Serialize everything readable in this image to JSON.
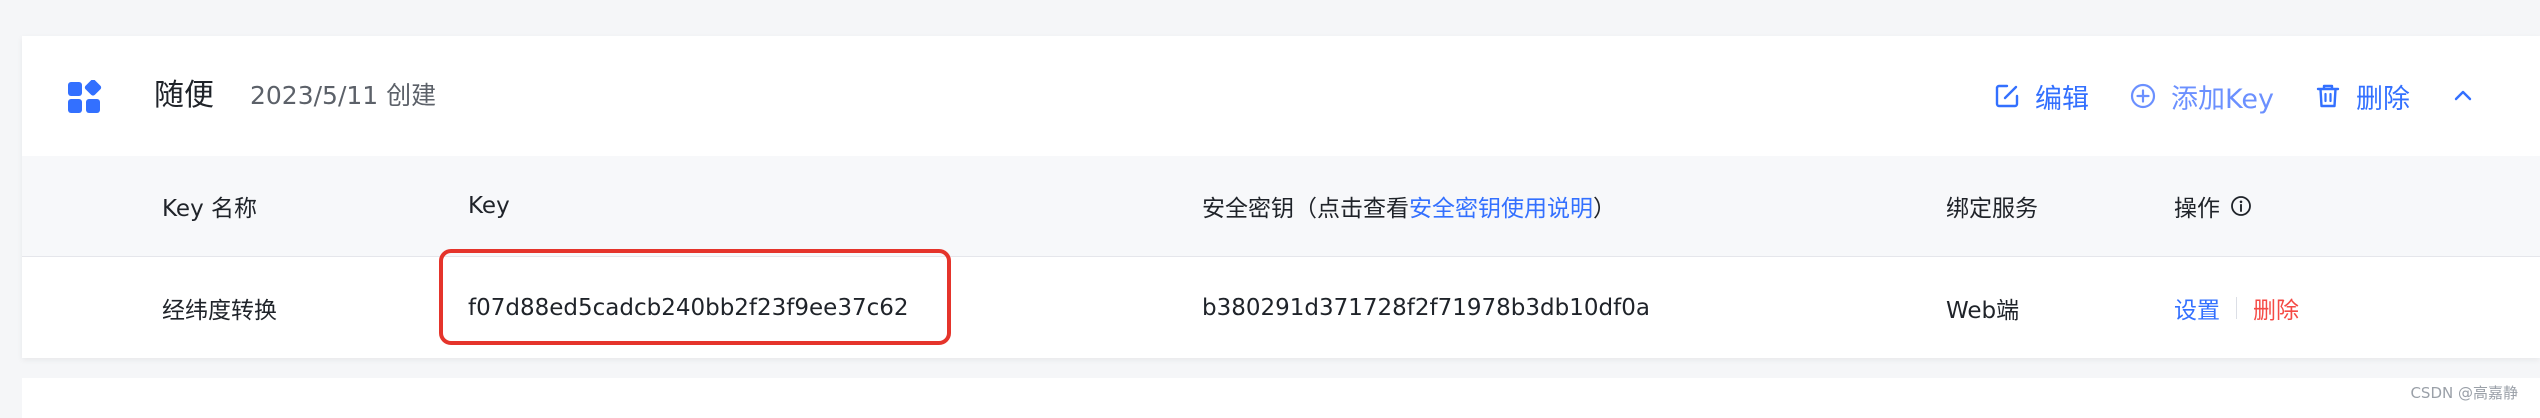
{
  "app": {
    "name": "随便",
    "created": "2023/5/11 创建"
  },
  "header_actions": {
    "edit_label": "编辑",
    "add_key_label": "添加Key",
    "delete_label": "删除"
  },
  "table": {
    "columns": {
      "key_name": "Key 名称",
      "key": "Key",
      "secret_prefix": "安全密钥（点击查看",
      "secret_link": "安全密钥使用说明",
      "secret_suffix": "）",
      "bound_service": "绑定服务",
      "operation": "操作"
    },
    "rows": [
      {
        "key_name": "经纬度转换",
        "key": "f07d88ed5cadcb240bb2f23f9ee37c62",
        "secret": "b380291d371728f2f71978b3db10df0a",
        "bound_service": "Web端",
        "op_settings": "设置",
        "op_delete": "删除"
      }
    ]
  },
  "watermark": "CSDN @高嘉静",
  "colors": {
    "accent": "#3370ff",
    "danger": "#f54a45",
    "highlight": "#e5342b"
  }
}
